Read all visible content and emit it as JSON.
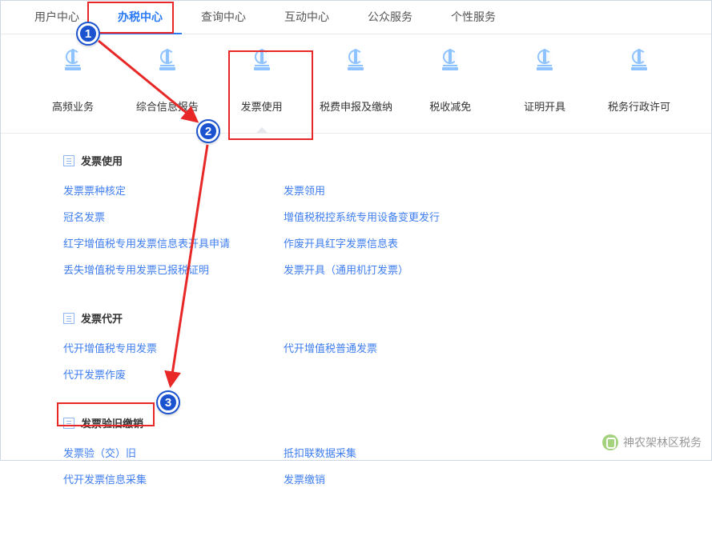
{
  "nav": {
    "items": [
      {
        "label": "用户中心"
      },
      {
        "label": "办税中心",
        "active": true
      },
      {
        "label": "查询中心"
      },
      {
        "label": "互动中心"
      },
      {
        "label": "公众服务"
      },
      {
        "label": "个性服务"
      }
    ]
  },
  "categories": [
    {
      "label": "高频业务"
    },
    {
      "label": "综合信息报告"
    },
    {
      "label": "发票使用",
      "active": true
    },
    {
      "label": "税费申报及缴纳"
    },
    {
      "label": "税收减免"
    },
    {
      "label": "证明开具"
    },
    {
      "label": "税务行政许可"
    }
  ],
  "sections": [
    {
      "title": "发票使用",
      "links": [
        "发票票种核定",
        "发票领用",
        "冠名发票",
        "增值税税控系统专用设备变更发行",
        "红字增值税专用发票信息表开具申请",
        "作废开具红字发票信息表",
        "丢失增值税专用发票已报税证明",
        "发票开具（通用机打发票）"
      ]
    },
    {
      "title": "发票代开",
      "links": [
        "代开增值税专用发票",
        "代开增值税普通发票",
        "代开发票作废"
      ]
    },
    {
      "title": "发票验旧缴销",
      "links": [
        "发票验（交）旧",
        "抵扣联数据采集",
        "代开发票信息采集",
        "发票缴销"
      ]
    }
  ],
  "annotations": {
    "badges": [
      "1",
      "2",
      "3"
    ],
    "watermark": "神农架林区税务"
  }
}
